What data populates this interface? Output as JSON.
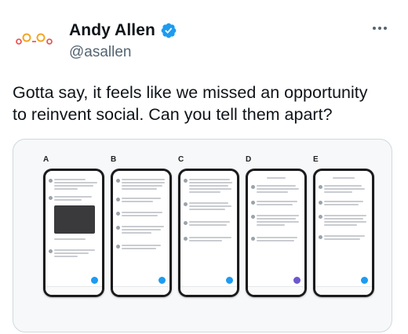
{
  "author": {
    "name": "Andy Allen",
    "handle": "@asallen",
    "avatar_icon": "andy-allen-logo",
    "verified_color": "#1d9bf0"
  },
  "tweet": {
    "text_lines": [
      "Gotta say, it feels like we missed an opportunity",
      "to reinvent social. Can you tell them apart?"
    ]
  },
  "media": {
    "panels": [
      {
        "letter": "A"
      },
      {
        "letter": "B"
      },
      {
        "letter": "C"
      },
      {
        "letter": "D"
      },
      {
        "letter": "E"
      }
    ]
  },
  "colors": {
    "text": "#0f1419",
    "secondary": "#536471",
    "border": "#cfd9de",
    "accent": "#1d9bf0"
  }
}
